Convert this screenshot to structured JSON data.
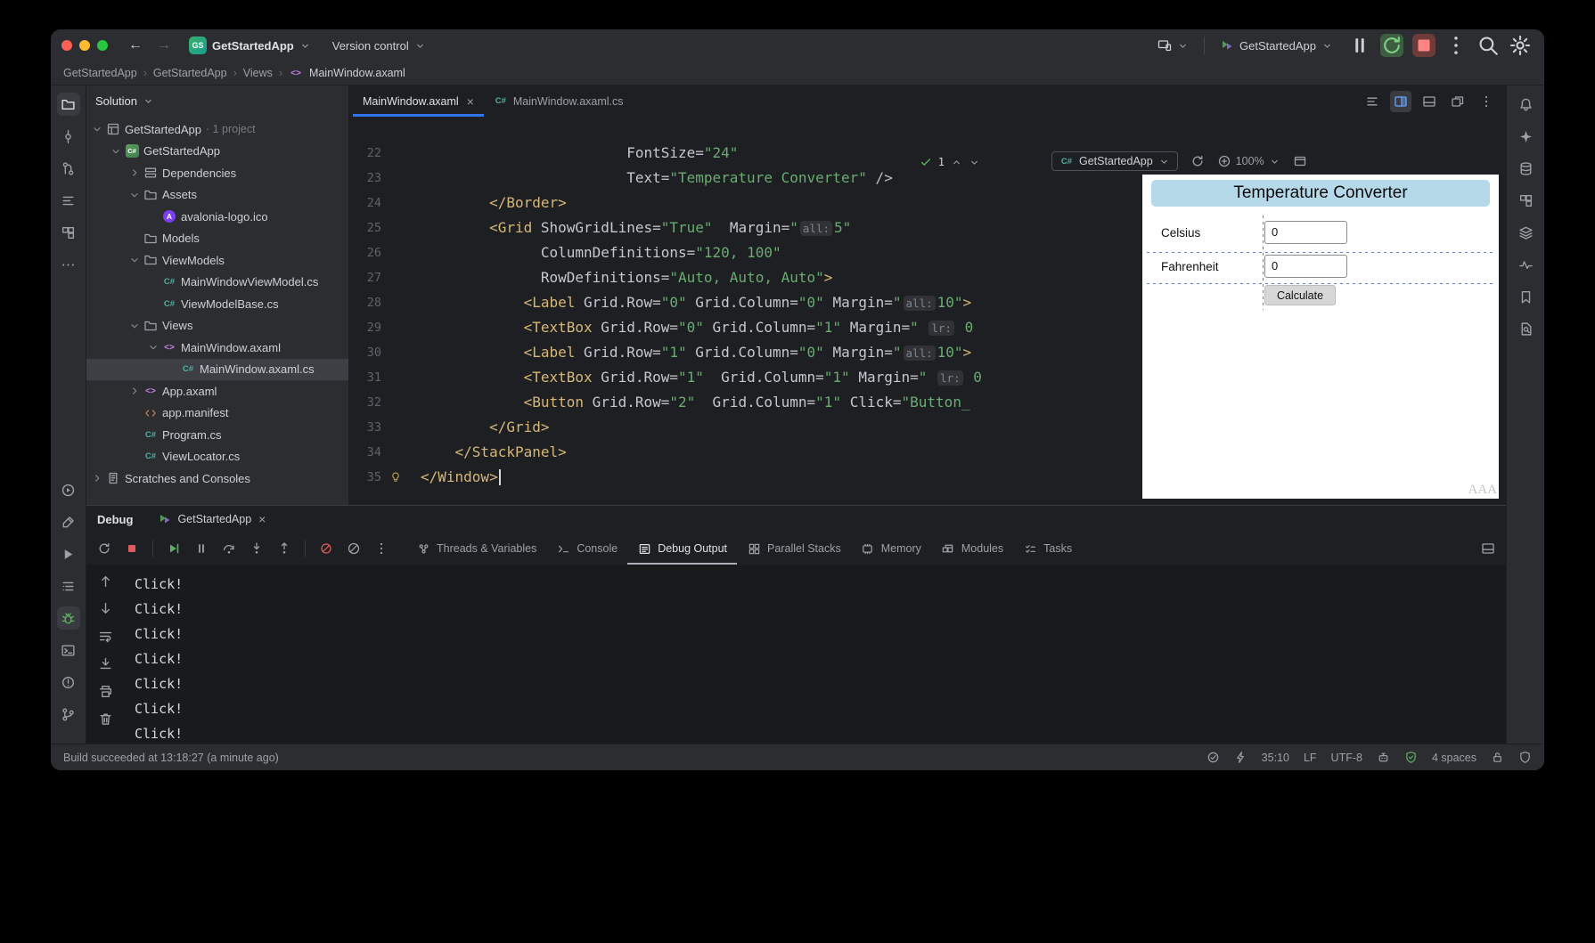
{
  "colors": {
    "accent": "#3574f0",
    "tag": "#d5b778",
    "string": "#6aab73",
    "stop_red": "#db5c5c",
    "run_green": "#5fad65",
    "preview_title_bg": "#b6d9ea",
    "gridline": "#5b7ed6",
    "selection": "#3d3f44"
  },
  "titlebar": {
    "project_badge": "GS",
    "project_name": "GetStartedApp",
    "version_control_label": "Version control",
    "run_config_name": "GetStartedApp"
  },
  "breadcrumbs": {
    "separator": "›",
    "items": [
      "GetStartedApp",
      "GetStartedApp",
      "Views",
      "MainWindow.axaml"
    ]
  },
  "solution": {
    "header_label": "Solution",
    "tree": [
      {
        "label": "GetStartedApp",
        "suffix": " · 1 project",
        "indent": 0,
        "chevron": "down",
        "icon": "solution"
      },
      {
        "label": "GetStartedApp",
        "indent": 1,
        "chevron": "down",
        "icon": "project"
      },
      {
        "label": "Dependencies",
        "indent": 2,
        "chevron": "right",
        "icon": "deps"
      },
      {
        "label": "Assets",
        "indent": 2,
        "chevron": "down",
        "icon": "folder"
      },
      {
        "label": "avalonia-logo.ico",
        "indent": 3,
        "chevron": null,
        "icon": "image"
      },
      {
        "label": "Models",
        "indent": 2,
        "chevron": null,
        "icon": "folder"
      },
      {
        "label": "ViewModels",
        "indent": 2,
        "chevron": "down",
        "icon": "folder"
      },
      {
        "label": "MainWindowViewModel.cs",
        "indent": 3,
        "chevron": null,
        "icon": "csharp"
      },
      {
        "label": "ViewModelBase.cs",
        "indent": 3,
        "chevron": null,
        "icon": "csharp"
      },
      {
        "label": "Views",
        "indent": 2,
        "chevron": "down",
        "icon": "folder"
      },
      {
        "label": "MainWindow.axaml",
        "indent": 3,
        "chevron": "down",
        "icon": "axaml"
      },
      {
        "label": "MainWindow.axaml.cs",
        "indent": 4,
        "chevron": null,
        "icon": "csharp",
        "selected": true
      },
      {
        "label": "App.axaml",
        "indent": 2,
        "chevron": "right",
        "icon": "axaml"
      },
      {
        "label": "app.manifest",
        "indent": 2,
        "chevron": null,
        "icon": "manifest"
      },
      {
        "label": "Program.cs",
        "indent": 2,
        "chevron": null,
        "icon": "csharp"
      },
      {
        "label": "ViewLocator.cs",
        "indent": 2,
        "chevron": null,
        "icon": "csharp"
      },
      {
        "label": "Scratches and Consoles",
        "indent": 0,
        "chevron": "right",
        "icon": "scratch"
      }
    ]
  },
  "editor": {
    "tabs": [
      {
        "label": "MainWindow.axaml",
        "icon": null,
        "active": true,
        "closable": true
      },
      {
        "label": "MainWindow.axaml.cs",
        "icon": "csharp",
        "active": false,
        "closable": false
      }
    ],
    "tab_actions": [
      {
        "name": "structure-view-icon",
        "icon": "structure",
        "active": false
      },
      {
        "name": "split-editor-icon",
        "icon": "splitright",
        "active": true
      },
      {
        "name": "layout-bottom-icon",
        "icon": "winbottom",
        "active": false
      },
      {
        "name": "detach-editor-icon",
        "icon": "float",
        "active": false
      },
      {
        "name": "more-options-icon",
        "icon": "kebab",
        "active": false
      }
    ],
    "inspections": {
      "count": "1"
    },
    "preview_toolbar": {
      "config_label": "GetStartedApp",
      "zoom": "100%"
    },
    "code": {
      "lines": [
        {
          "num": "22",
          "indent": 24,
          "tokens": [
            [
              "attr",
              "FontSize"
            ],
            [
              "p",
              "="
            ],
            [
              "str",
              "\"24\""
            ]
          ]
        },
        {
          "num": "23",
          "indent": 24,
          "tokens": [
            [
              "attr",
              "Text"
            ],
            [
              "p",
              "="
            ],
            [
              "str",
              "\"Temperature Converter\""
            ],
            [
              "p",
              " />"
            ]
          ]
        },
        {
          "num": "24",
          "indent": 8,
          "tokens": [
            [
              "tag",
              "</Border>"
            ]
          ]
        },
        {
          "num": "25",
          "indent": 8,
          "tokens": [
            [
              "tag",
              "<Grid"
            ],
            [
              "p",
              " "
            ],
            [
              "attr",
              "ShowGridLines"
            ],
            [
              "p",
              "="
            ],
            [
              "str",
              "\"True\""
            ],
            [
              "p",
              "  "
            ],
            [
              "attr",
              "Margin"
            ],
            [
              "p",
              "="
            ],
            [
              "str",
              "\""
            ],
            [
              "hint",
              "all:"
            ],
            [
              "str",
              "5\""
            ]
          ]
        },
        {
          "num": "26",
          "indent": 14,
          "tokens": [
            [
              "attr",
              "ColumnDefinitions"
            ],
            [
              "p",
              "="
            ],
            [
              "str",
              "\"120, 100\""
            ]
          ]
        },
        {
          "num": "27",
          "indent": 14,
          "tokens": [
            [
              "attr",
              "RowDefinitions"
            ],
            [
              "p",
              "="
            ],
            [
              "str",
              "\"Auto, Auto, Auto\""
            ],
            [
              "tag",
              ">"
            ]
          ]
        },
        {
          "num": "28",
          "indent": 12,
          "tokens": [
            [
              "tag",
              "<Label"
            ],
            [
              "p",
              " "
            ],
            [
              "attr",
              "Grid.Row"
            ],
            [
              "p",
              "="
            ],
            [
              "str",
              "\"0\""
            ],
            [
              "p",
              " "
            ],
            [
              "attr",
              "Grid.Column"
            ],
            [
              "p",
              "="
            ],
            [
              "str",
              "\"0\""
            ],
            [
              "p",
              " "
            ],
            [
              "attr",
              "Margin"
            ],
            [
              "p",
              "="
            ],
            [
              "str",
              "\""
            ],
            [
              "hint",
              "all:"
            ],
            [
              "str",
              "10\""
            ],
            [
              "tag",
              ">"
            ]
          ]
        },
        {
          "num": "29",
          "indent": 12,
          "tokens": [
            [
              "tag",
              "<TextBox"
            ],
            [
              "p",
              " "
            ],
            [
              "attr",
              "Grid.Row"
            ],
            [
              "p",
              "="
            ],
            [
              "str",
              "\"0\""
            ],
            [
              "p",
              " "
            ],
            [
              "attr",
              "Grid.Column"
            ],
            [
              "p",
              "="
            ],
            [
              "str",
              "\"1\""
            ],
            [
              "p",
              " "
            ],
            [
              "attr",
              "Margin"
            ],
            [
              "p",
              "="
            ],
            [
              "str",
              "\" "
            ],
            [
              "hint",
              "lr:"
            ],
            [
              "str",
              " 0"
            ]
          ]
        },
        {
          "num": "30",
          "indent": 12,
          "tokens": [
            [
              "tag",
              "<Label"
            ],
            [
              "p",
              " "
            ],
            [
              "attr",
              "Grid.Row"
            ],
            [
              "p",
              "="
            ],
            [
              "str",
              "\"1\""
            ],
            [
              "p",
              " "
            ],
            [
              "attr",
              "Grid.Column"
            ],
            [
              "p",
              "="
            ],
            [
              "str",
              "\"0\""
            ],
            [
              "p",
              " "
            ],
            [
              "attr",
              "Margin"
            ],
            [
              "p",
              "="
            ],
            [
              "str",
              "\""
            ],
            [
              "hint",
              "all:"
            ],
            [
              "str",
              "10\""
            ],
            [
              "tag",
              ">"
            ]
          ]
        },
        {
          "num": "31",
          "indent": 12,
          "tokens": [
            [
              "tag",
              "<TextBox"
            ],
            [
              "p",
              " "
            ],
            [
              "attr",
              "Grid.Row"
            ],
            [
              "p",
              "="
            ],
            [
              "str",
              "\"1\""
            ],
            [
              "p",
              "  "
            ],
            [
              "attr",
              "Grid.Column"
            ],
            [
              "p",
              "="
            ],
            [
              "str",
              "\"1\""
            ],
            [
              "p",
              " "
            ],
            [
              "attr",
              "Margin"
            ],
            [
              "p",
              "="
            ],
            [
              "str",
              "\" "
            ],
            [
              "hint",
              "lr:"
            ],
            [
              "str",
              " 0"
            ]
          ]
        },
        {
          "num": "32",
          "indent": 12,
          "tokens": [
            [
              "tag",
              "<Button"
            ],
            [
              "p",
              " "
            ],
            [
              "attr",
              "Grid.Row"
            ],
            [
              "p",
              "="
            ],
            [
              "str",
              "\"2\""
            ],
            [
              "p",
              "  "
            ],
            [
              "attr",
              "Grid.Column"
            ],
            [
              "p",
              "="
            ],
            [
              "str",
              "\"1\""
            ],
            [
              "p",
              " "
            ],
            [
              "attr",
              "Click"
            ],
            [
              "p",
              "="
            ],
            [
              "str",
              "\"Button_"
            ]
          ]
        },
        {
          "num": "33",
          "indent": 8,
          "tokens": [
            [
              "tag",
              "</Grid>"
            ]
          ]
        },
        {
          "num": "34",
          "indent": 4,
          "tokens": [
            [
              "tag",
              "</StackPanel>"
            ]
          ]
        },
        {
          "num": "35",
          "indent": 0,
          "tokens": [
            [
              "tag",
              "</Window>"
            ]
          ],
          "cursor": true,
          "gutter_icon": "bulb"
        }
      ]
    }
  },
  "preview": {
    "title": "Temperature Converter",
    "rows": [
      {
        "label": "Celsius",
        "value": "0"
      },
      {
        "label": "Fahrenheit",
        "value": "0"
      }
    ],
    "button_label": "Calculate",
    "watermark": "AAA"
  },
  "debug": {
    "panel_title": "Debug",
    "session_tab": "GetStartedApp",
    "toolbar": [
      {
        "name": "rerun-debugger-button",
        "icon": "rerun"
      },
      {
        "name": "stop-button",
        "icon": "stop",
        "cls": "red"
      },
      {
        "sep": true
      },
      {
        "name": "resume-button",
        "icon": "resume",
        "cls": "green"
      },
      {
        "name": "pause-button",
        "icon": "pause"
      },
      {
        "name": "step-over-button",
        "icon": "stepover"
      },
      {
        "name": "step-into-button",
        "icon": "stepinto"
      },
      {
        "name": "step-out-button",
        "icon": "stepout"
      },
      {
        "sep": true
      },
      {
        "name": "mute-breakpoints-button",
        "icon": "mutebp",
        "cls": "red"
      },
      {
        "name": "dont-suspend-button",
        "icon": "slash"
      },
      {
        "name": "more-debug-actions-button",
        "icon": "kebab"
      }
    ],
    "tabs": [
      {
        "label": "Threads & Variables",
        "icon": "threads",
        "active": false
      },
      {
        "label": "Console",
        "icon": "console",
        "active": false
      },
      {
        "label": "Debug Output",
        "icon": "output",
        "active": true
      },
      {
        "label": "Parallel Stacks",
        "icon": "stacks",
        "active": false
      },
      {
        "label": "Memory",
        "icon": "memory",
        "active": false
      },
      {
        "label": "Modules",
        "icon": "modules",
        "active": false
      },
      {
        "label": "Tasks",
        "icon": "tasks",
        "active": false
      }
    ],
    "console_toolbar": [
      {
        "name": "scroll-to-top-button",
        "icon": "up"
      },
      {
        "name": "scroll-to-bottom-button",
        "icon": "down"
      },
      {
        "name": "soft-wrap-button",
        "icon": "softwrap"
      },
      {
        "name": "scroll-to-end-button",
        "icon": "scrollend"
      },
      {
        "name": "print-output-button",
        "icon": "print"
      },
      {
        "name": "clear-console-button",
        "icon": "trash"
      }
    ],
    "console_lines": [
      "Click!",
      "Click!",
      "Click!",
      "Click!",
      "Click!",
      "Click!",
      "Click!"
    ]
  },
  "status_bar": {
    "message": "Build succeeded at 13:18:27 (a minute ago)",
    "caret": "35:10",
    "line_ending": "LF",
    "encoding": "UTF-8",
    "indent": "4 spaces"
  },
  "strips": {
    "left_top": [
      {
        "name": "project-tool-icon",
        "icon": "folder",
        "active": true
      },
      {
        "name": "commit-tool-icon",
        "icon": "commit"
      },
      {
        "name": "pull-requests-icon",
        "icon": "prs"
      },
      {
        "name": "structure-tool-icon",
        "icon": "structure"
      },
      {
        "name": "nuget-tool-icon",
        "icon": "boxes"
      },
      {
        "name": "more-tool-windows-icon",
        "icon": "more"
      }
    ],
    "left_bottom": [
      {
        "name": "services-tool-icon",
        "icon": "services"
      },
      {
        "name": "build-tool-icon",
        "icon": "build"
      },
      {
        "name": "run-tool-icon",
        "icon": "run"
      },
      {
        "name": "todo-tool-icon",
        "icon": "todo"
      },
      {
        "name": "debug-tool-icon",
        "icon": "bug",
        "activegreen": true
      },
      {
        "name": "terminal-tool-icon",
        "icon": "terminal"
      },
      {
        "name": "problems-tool-icon",
        "icon": "problems"
      },
      {
        "name": "git-tool-icon",
        "icon": "branch"
      }
    ],
    "right": [
      {
        "name": "notifications-icon",
        "icon": "bell"
      },
      {
        "name": "ai-assistant-icon",
        "icon": "sparkle"
      },
      {
        "name": "database-tool-icon",
        "icon": "database"
      },
      {
        "name": "build-tools-icon",
        "icon": "boxes"
      },
      {
        "name": "endpoints-icon",
        "icon": "layers"
      },
      {
        "name": "profiler-icon",
        "icon": "pulse"
      },
      {
        "name": "bookmarks-icon",
        "icon": "bookmark"
      },
      {
        "name": "documentation-icon",
        "icon": "docsearch"
      }
    ]
  }
}
